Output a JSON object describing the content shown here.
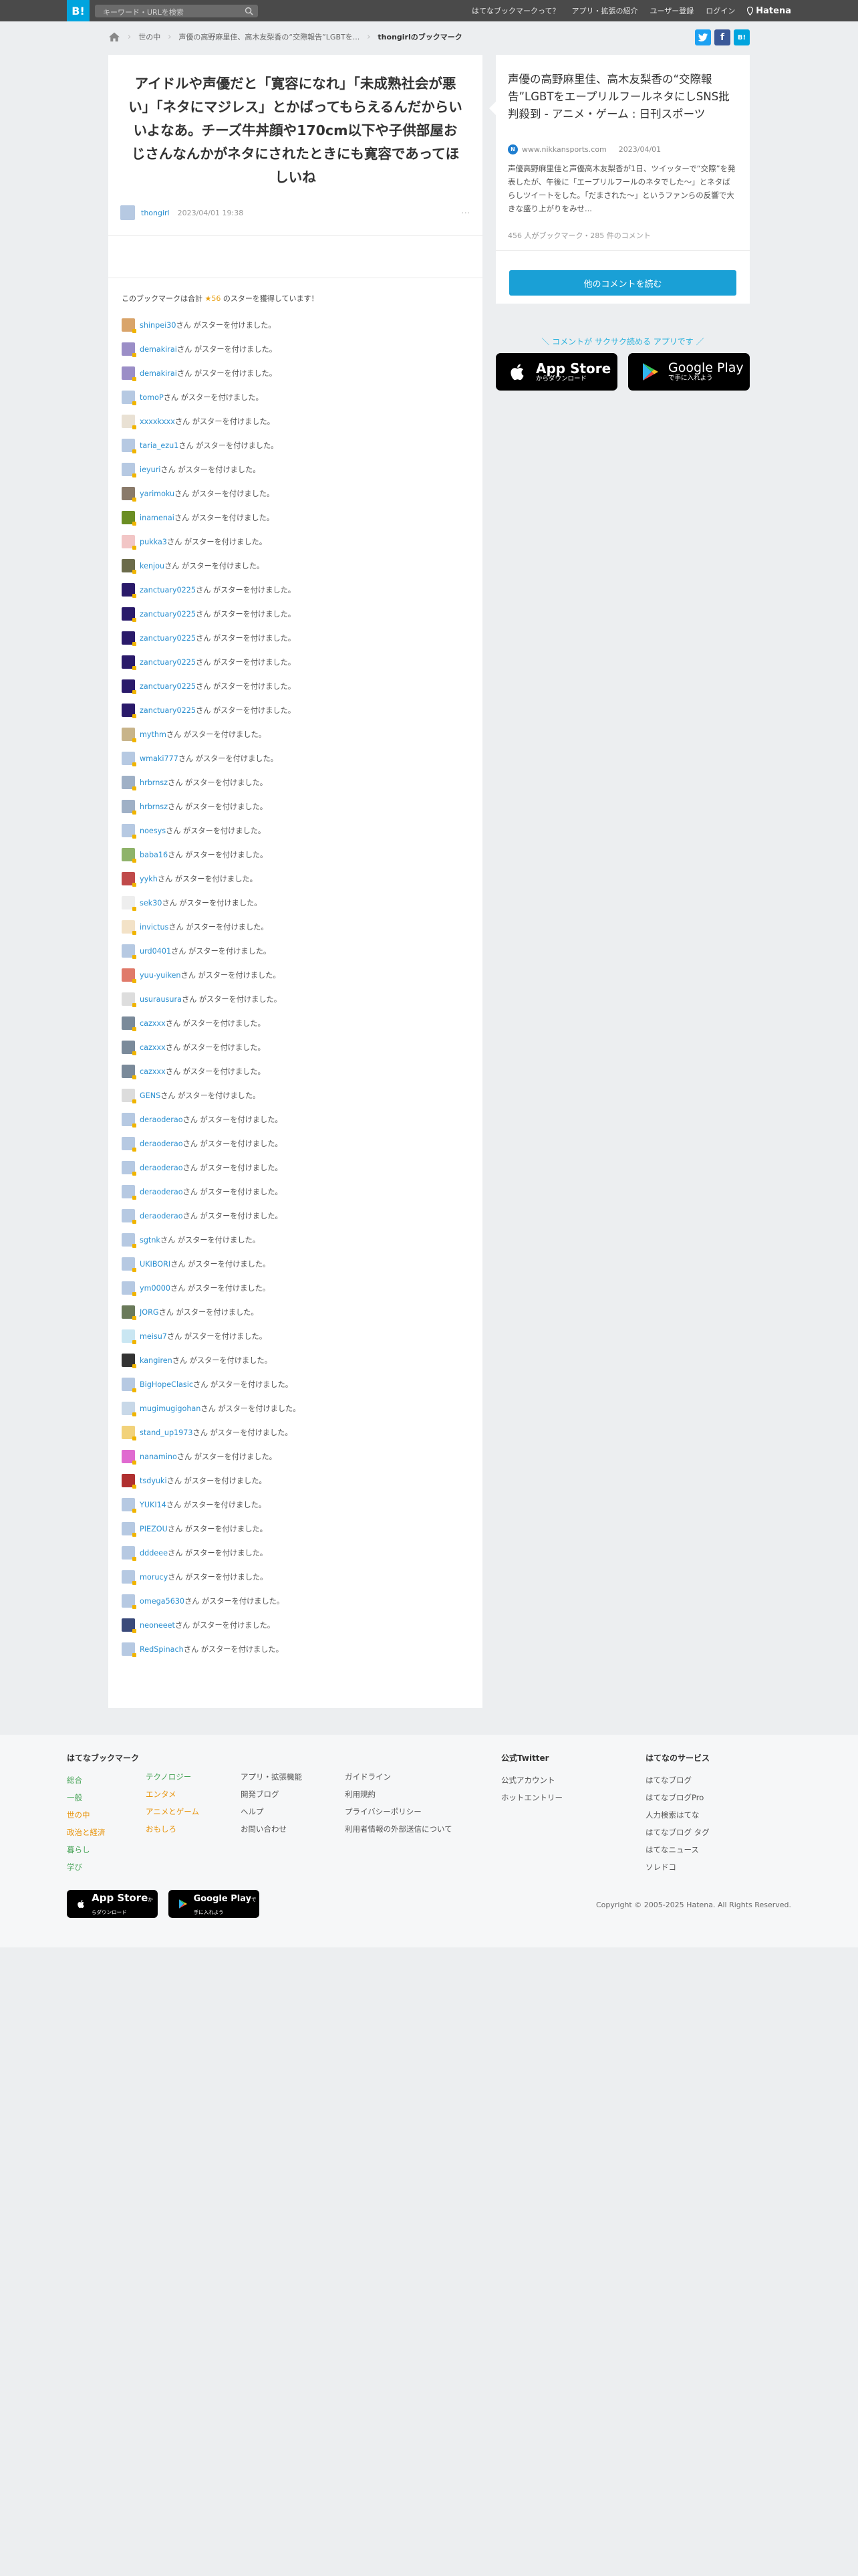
{
  "header": {
    "logo": "B!",
    "search_placeholder": "キーワード・URLを検索",
    "nav": [
      "はてなブックマークって？",
      "アプリ・拡張の紹介",
      "ユーザー登録",
      "ログイン"
    ],
    "brand": "Hatena"
  },
  "breadcrumb": {
    "items": [
      "世の中",
      "声優の高野麻里佳、高木友梨香の“交際報告”LGBTを..."
    ],
    "current": "thongirlのブックマーク"
  },
  "main": {
    "headline": "アイドルや声優だと「寛容になれ」「未成熟社会が悪い」「ネタにマジレス」とかばってもらえるんだからいいよなあ。チーズ牛丼顔や170cm以下や子供部屋おじさんなんかがネタにされたときにも寛容であってほしいね",
    "user": "thongirl",
    "date": "2023/04/01 19:38",
    "more": "···",
    "summary_pre": "このブックマークは合計",
    "summary_count": "★56",
    "summary_post": "のスターを獲得しています！",
    "star_suffix": "さん がスターを付けました。",
    "stars": [
      {
        "name": "shinpei30",
        "color": "#d9a46a"
      },
      {
        "name": "demakirai",
        "color": "#9b8ec7"
      },
      {
        "name": "demakirai",
        "color": "#9b8ec7"
      },
      {
        "name": "tomoP",
        "color": "#b6c9e2"
      },
      {
        "name": "xxxxkxxx",
        "color": "#e9e1d4"
      },
      {
        "name": "taria_ezu1",
        "color": "#b6c9e2"
      },
      {
        "name": "ieyuri",
        "color": "#b6c9e2"
      },
      {
        "name": "yarimoku",
        "color": "#8a7a6a"
      },
      {
        "name": "inamenai",
        "color": "#6b8e23"
      },
      {
        "name": "pukka3",
        "color": "#f2c6c6"
      },
      {
        "name": "kenjou",
        "color": "#6b6b4a"
      },
      {
        "name": "zanctuary0225",
        "color": "#2a1a6a"
      },
      {
        "name": "zanctuary0225",
        "color": "#2a1a6a"
      },
      {
        "name": "zanctuary0225",
        "color": "#2a1a6a"
      },
      {
        "name": "zanctuary0225",
        "color": "#2a1a6a"
      },
      {
        "name": "zanctuary0225",
        "color": "#2a1a6a"
      },
      {
        "name": "zanctuary0225",
        "color": "#2a1a6a"
      },
      {
        "name": "mythm",
        "color": "#c8b48a"
      },
      {
        "name": "wmaki777",
        "color": "#b6c9e2"
      },
      {
        "name": "hrbrnsz",
        "color": "#9fb0c6"
      },
      {
        "name": "hrbrnsz",
        "color": "#9fb0c6"
      },
      {
        "name": "noesys",
        "color": "#b6c9e2"
      },
      {
        "name": "baba16",
        "color": "#8fb36a"
      },
      {
        "name": "yykh",
        "color": "#c04a4a"
      },
      {
        "name": "sek30",
        "color": "#eeeeee"
      },
      {
        "name": "invictus",
        "color": "#f3e2c7"
      },
      {
        "name": "urd0401",
        "color": "#b6c9e2"
      },
      {
        "name": "yuu-yuiken",
        "color": "#e07a6a"
      },
      {
        "name": "usurausura",
        "color": "#dddddd"
      },
      {
        "name": "cazxxx",
        "color": "#7a8a9a"
      },
      {
        "name": "cazxxx",
        "color": "#7a8a9a"
      },
      {
        "name": "cazxxx",
        "color": "#7a8a9a"
      },
      {
        "name": "GENS",
        "color": "#dcdcdc"
      },
      {
        "name": "deraoderao",
        "color": "#b6c9e2"
      },
      {
        "name": "deraoderao",
        "color": "#b6c9e2"
      },
      {
        "name": "deraoderao",
        "color": "#b6c9e2"
      },
      {
        "name": "deraoderao",
        "color": "#b6c9e2"
      },
      {
        "name": "deraoderao",
        "color": "#b6c9e2"
      },
      {
        "name": "sgtnk",
        "color": "#b6c9e2"
      },
      {
        "name": "UKIBORI",
        "color": "#b6c9e2"
      },
      {
        "name": "ym0000",
        "color": "#b6c9e2"
      },
      {
        "name": "JORG",
        "color": "#6a7a5a"
      },
      {
        "name": "meisu7",
        "color": "#c9e6f2"
      },
      {
        "name": "kangiren",
        "color": "#333333"
      },
      {
        "name": "BigHopeClasic",
        "color": "#b6c9e2"
      },
      {
        "name": "mugimugigohan",
        "color": "#c8d8e8"
      },
      {
        "name": "stand_up1973",
        "color": "#f2d27a"
      },
      {
        "name": "nanamino",
        "color": "#e06ad0"
      },
      {
        "name": "tsdyuki",
        "color": "#b03030"
      },
      {
        "name": "YUKI14",
        "color": "#b6c9e2"
      },
      {
        "name": "PIEZOU",
        "color": "#b6c9e2"
      },
      {
        "name": "dddeee",
        "color": "#b6c9e2"
      },
      {
        "name": "morucy",
        "color": "#b6c9e2"
      },
      {
        "name": "omega5630",
        "color": "#b6c9e2"
      },
      {
        "name": "neoneeet",
        "color": "#3a4a7a"
      },
      {
        "name": "RedSpinach",
        "color": "#b6c9e2"
      }
    ]
  },
  "entry": {
    "title": "声優の高野麻里佳、高木友梨香の“交際報告”LGBTをエープリルフールネタにしSNS批判殺到 - アニメ・ゲーム : 日刊スポーツ",
    "source": "www.nikkansports.com",
    "date": "2023/04/01",
    "description": "声優高野麻里佳と声優高木友梨香が1日、ツイッターで“交際”を発表したが、午後に「エープリルフールのネタでした～」とネタばらしツイートをした。「だまされた～」というファンらの反響で大きな盛り上がりをみせ...",
    "counts": "456 人がブックマーク・285 件のコメント",
    "comment_button": "他のコメントを読む"
  },
  "promo": "＼ コメントが サクサク読める アプリです ／",
  "badges": {
    "appstore_big": "App Store",
    "appstore_small": "からダウンロード",
    "google_big": "Google Play",
    "google_small": "で手に入れよう"
  },
  "footer": {
    "title": "はてなブックマーク",
    "col1": [
      "総合",
      "一般",
      "世の中",
      "政治と経済",
      "暮らし",
      "学び"
    ],
    "col2": [
      "テクノロジー",
      "エンタメ",
      "アニメとゲーム",
      "おもしろ"
    ],
    "col3": [
      "アプリ・拡張機能",
      "開発ブログ",
      "ヘルプ",
      "お問い合わせ"
    ],
    "col4": [
      "ガイドライン",
      "利用規約",
      "プライバシーポリシー",
      "利用者情報の外部送信について"
    ],
    "twitter_title": "公式Twitter",
    "twitter": [
      "公式アカウント",
      "ホットエントリー"
    ],
    "services_title": "はてなのサービス",
    "services": [
      "はてなブログ",
      "はてなブログPro",
      "人力検索はてな",
      "はてなブログ タグ",
      "はてなニュース",
      "ソレドコ"
    ],
    "copyright": "Copyright © 2005-2025 Hatena. All Rights Reserved."
  },
  "colors": {
    "header_bg": "#4a4a4a",
    "brand_blue": "#00a4de",
    "link": "#2a8fd0",
    "star": "#e89d0b"
  }
}
